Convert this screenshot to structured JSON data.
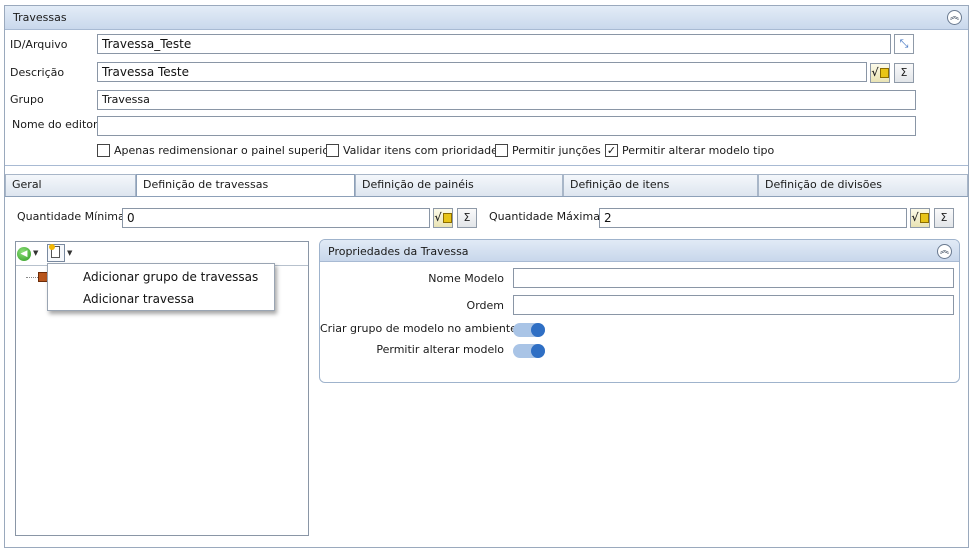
{
  "header": {
    "title": "Travessas"
  },
  "form": {
    "id_label": "ID/Arquivo",
    "id_value": "Travessa_Teste",
    "desc_label": "Descrição",
    "desc_value": "Travessa Teste",
    "group_label": "Grupo",
    "group_value": "Travessa",
    "editor_label": "Nome do editor",
    "editor_value": ""
  },
  "checkboxes": [
    {
      "label": "Apenas redimensionar o painel superior",
      "checked": false
    },
    {
      "label": "Validar itens com prioridade",
      "checked": false
    },
    {
      "label": "Permitir junções",
      "checked": false
    },
    {
      "label": "Permitir alterar modelo tipo",
      "checked": true
    }
  ],
  "tabs": [
    {
      "label": "Geral",
      "active": false
    },
    {
      "label": "Definição de travessas",
      "active": true
    },
    {
      "label": "Definição de painéis",
      "active": false
    },
    {
      "label": "Definição de itens",
      "active": false
    },
    {
      "label": "Definição de divisões",
      "active": false
    }
  ],
  "quantity": {
    "min_label": "Quantidade Mínima",
    "min_value": "0",
    "max_label": "Quantidade Máxima",
    "max_value": "2"
  },
  "buttons": {
    "sigma": "Σ",
    "sqrt": "√"
  },
  "context_menu": {
    "items": [
      "Adicionar grupo de travessas",
      "Adicionar travessa"
    ]
  },
  "properties": {
    "title": "Propriedades da Travessa",
    "name_label": "Nome Modelo",
    "name_value": "",
    "order_label": "Ordem",
    "order_value": "",
    "create_group_label": "Criar grupo de modelo no ambiente",
    "create_group_on": true,
    "allow_change_label": "Permitir alterar modelo",
    "allow_change_on": true
  },
  "colors": {
    "accent": "#2f6fc4",
    "header": "#c9d8ec"
  }
}
